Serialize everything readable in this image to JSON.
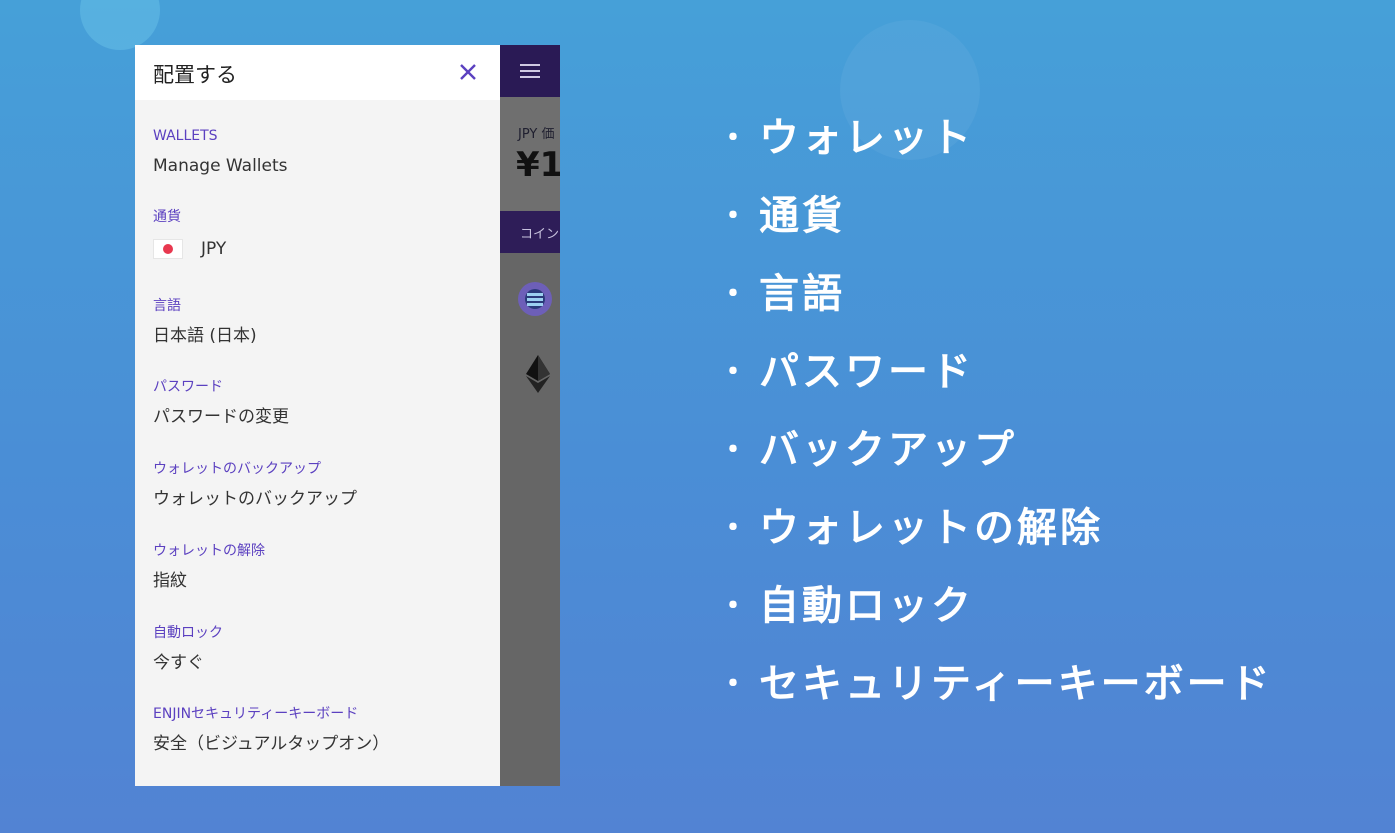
{
  "drawer": {
    "title": "配置する",
    "sections": [
      {
        "label": "WALLETS",
        "value": "Manage Wallets"
      },
      {
        "label": "通貨",
        "value": "JPY"
      },
      {
        "label": "言語",
        "value": "日本語 (日本)"
      },
      {
        "label": "パスワード",
        "value": "パスワードの変更"
      },
      {
        "label": "ウォレットのバックアップ",
        "value": "ウォレットのバックアップ"
      },
      {
        "label": "ウォレットの解除",
        "value": "指紋"
      },
      {
        "label": "自動ロック",
        "value": "今すぐ"
      },
      {
        "label": "ENJINセキュリティーキーボード",
        "value": "安全（ビジュアルタップオン）"
      }
    ]
  },
  "background_app": {
    "balance_label": "JPY 価",
    "balance_value": "¥1,",
    "tab_label": "コイン"
  },
  "features": [
    "ウォレット",
    "通貨",
    "言語",
    "パスワード",
    "バックアップ",
    "ウォレットの解除",
    "自動ロック",
    "セキュリティーキーボード"
  ],
  "bullet": "・",
  "colors": {
    "accent": "#5b40c0",
    "appbar": "#2a1a55",
    "flag_red": "#e8384f"
  },
  "icons": {
    "close": "close-icon",
    "menu": "menu-icon",
    "flag": "japan-flag-icon",
    "coin1": "enjin-coin-icon",
    "coin2": "ethereum-icon"
  }
}
